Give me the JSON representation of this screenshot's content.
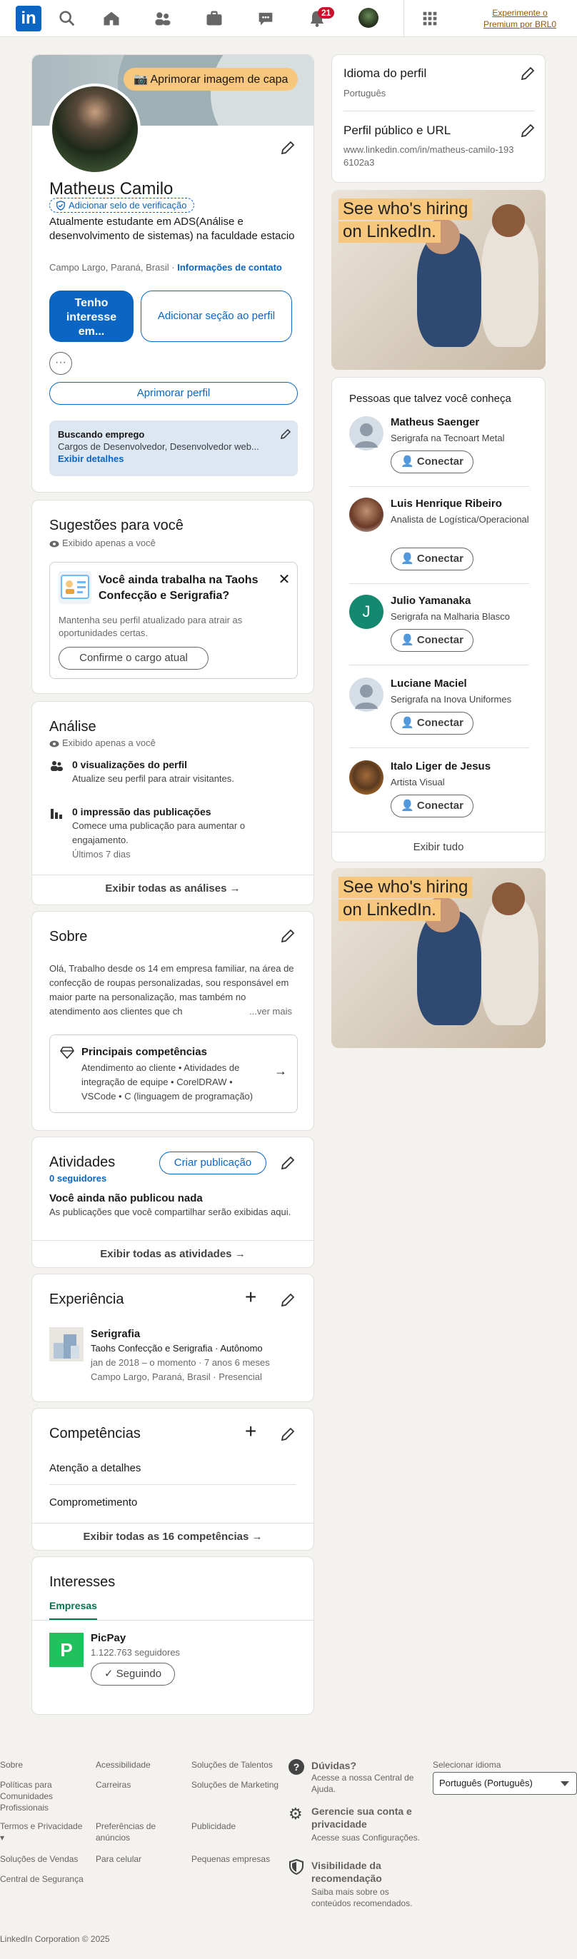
{
  "nav": {
    "logo": "in",
    "notifications_count": "21",
    "premium_label": "Experimente o Premium por BRL0"
  },
  "profile": {
    "improve_cover": "Aprimorar imagem de capa",
    "name": "Matheus Camilo",
    "verify": "Adicionar selo de verificação",
    "headline": "Atualmente estudante em ADS(Análise e desenvolvimento de sistemas) na faculdade estacio",
    "location": "Campo Largo, Paraná, Brasil",
    "contact_info": "Informações de contato",
    "open_to": "Tenho interesse em...",
    "add_section": "Adicionar seção ao perfil",
    "more": "···",
    "improve_profile": "Aprimorar perfil",
    "open_to_work": {
      "title": "Buscando emprego",
      "roles": "Cargos de Desenvolvedor, Desenvolvedor web...",
      "details": "Exibir detalhes"
    }
  },
  "suggestions": {
    "title": "Sugestões para você",
    "private": "Exibido apenas a você",
    "card_title": "Você ainda trabalha na Taohs Confecção e Serigrafia?",
    "card_text": "Mantenha seu perfil atualizado para atrair as oportunidades certas.",
    "card_button": "Confirme o cargo atual"
  },
  "analytics": {
    "title": "Análise",
    "private": "Exibido apenas a você",
    "views_title": "0 visualizações do perfil",
    "views_sub": "Atualize seu perfil para atrair visitantes.",
    "impressions_title": "0 impressão das publicações",
    "impressions_sub": "Comece uma publicação para aumentar o engajamento.",
    "period": "Últimos 7 dias",
    "show_all": "Exibir todas as análises →"
  },
  "about": {
    "title": "Sobre",
    "text": "Olá, Trabalho desde os 14 em empresa familiar, na área de confecção de roupas personalizadas, sou responsável em maior parte na personalização, mas também no atendimento aos clientes que ch",
    "see_more": "...ver mais",
    "skills_title": "Principais competências",
    "skills_text": "Atendimento ao cliente • Atividades de integração de equipe • CorelDRAW • VSCode • C (linguagem de programação)"
  },
  "activity": {
    "title": "Atividades",
    "followers": "0 seguidores",
    "create_post": "Criar publicação",
    "none_title": "Você ainda não publicou nada",
    "none_sub": "As publicações que você compartilhar serão exibidas aqui.",
    "show_all": "Exibir todas as atividades →"
  },
  "experience": {
    "title": "Experiência",
    "role": "Serigrafia",
    "company": "Taohs Confecção e Serigrafia · Autônomo",
    "dates": "jan de 2018 – o momento · 7 anos 6 meses",
    "place": "Campo Largo, Paraná, Brasil · Presencial"
  },
  "skills": {
    "title": "Competências",
    "items": [
      "Atenção a detalhes",
      "Comprometimento"
    ],
    "show_all": "Exibir todas as 16 competências →"
  },
  "interests": {
    "title": "Interesses",
    "tab": "Empresas",
    "company": "PicPay",
    "followers": "1.122.763 seguidores",
    "following": "✓ Seguindo"
  },
  "sidebar": {
    "language_title": "Idioma do perfil",
    "language_value": "Português",
    "url_title": "Perfil público e URL",
    "url_value": "www.linkedin.com/in/matheus-camilo-1936102a3",
    "ad_line1": "See who's hiring",
    "ad_line2": "on LinkedIn.",
    "pymk_title": "Pessoas que talvez você conheça",
    "connect_label": "Conectar",
    "people": [
      {
        "name": "Matheus Saenger",
        "desc": "Serigrafa na Tecnoart Metal"
      },
      {
        "name": "Luis Henrique Ribeiro",
        "desc": "Analista de Logística/Operacional"
      },
      {
        "name": "Julio Yamanaka",
        "desc": "Serigrafa na Malharia Blasco",
        "initial": "J"
      },
      {
        "name": "Luciane Maciel",
        "desc": "Serigrafa na Inova Uniformes"
      },
      {
        "name": "Italo Liger de Jesus",
        "desc": "Artista Visual"
      }
    ],
    "show_all": "Exibir tudo"
  },
  "footer": {
    "col1": [
      "Sobre",
      "Políticas para Comunidades Profissionais",
      "Termos e Privacidade ▾",
      "Soluções de Vendas",
      "Central de Segurança"
    ],
    "col2": [
      "Acessibilidade",
      "Carreiras",
      "Preferências de anúncios",
      "Para celular"
    ],
    "col3": [
      "Soluções de Talentos",
      "Soluções de Marketing",
      "Publicidade",
      "Pequenas empresas"
    ],
    "help1_title": "Dúvidas?",
    "help1_sub": "Acesse a nossa Central de Ajuda.",
    "help2_title": "Gerencie sua conta e privacidade",
    "help2_sub": "Acesse suas Configurações.",
    "help3_title": "Visibilidade da recomendação",
    "help3_sub": "Saiba mais sobre os conteúdos recomendados.",
    "lang_label": "Selecionar idioma",
    "lang_value": "Português (Português)",
    "copyright": "LinkedIn Corporation © 2025"
  },
  "colors": {
    "brand": "#0a66c2",
    "background": "#f4f2ee",
    "premium": "#915907",
    "badge": "#cb112d"
  }
}
